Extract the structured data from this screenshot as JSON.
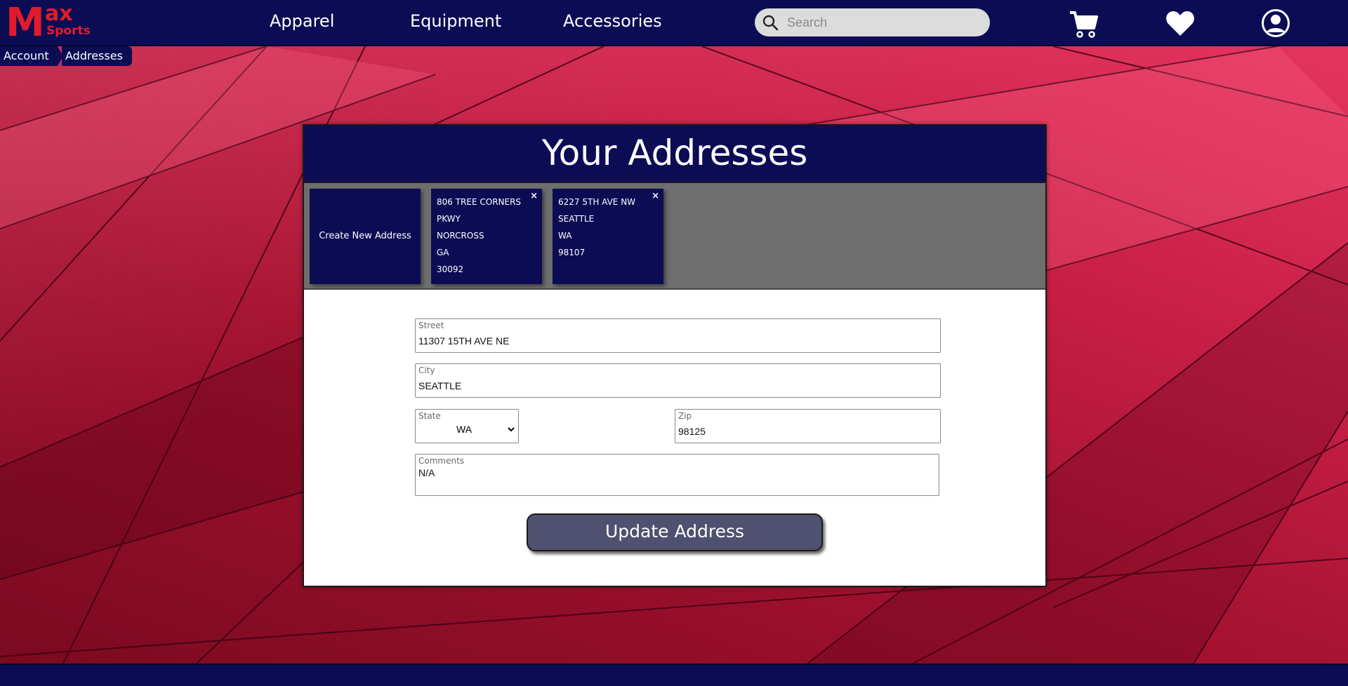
{
  "logo": {
    "m": "M",
    "ax": "ax",
    "sports": "Sports"
  },
  "nav": [
    {
      "label": "Apparel"
    },
    {
      "label": "Equipment"
    },
    {
      "label": "Accessories"
    }
  ],
  "search": {
    "placeholder": "Search",
    "value": ""
  },
  "header_icons": [
    "cart-icon",
    "heart-icon",
    "user-icon"
  ],
  "breadcrumb": [
    {
      "label": "Account"
    },
    {
      "label": "Addresses"
    }
  ],
  "page_title": "Your Addresses",
  "create_card": {
    "label": "Create New Address"
  },
  "address_cards": [
    {
      "lines": [
        "806 TREE CORNERS",
        "PKWY",
        "NORCROSS",
        "GA",
        "30092"
      ],
      "close": "×"
    },
    {
      "lines": [
        "6227 5TH AVE NW",
        "SEATTLE",
        "WA",
        "98107"
      ],
      "close": "×"
    }
  ],
  "form": {
    "street": {
      "label": "Street",
      "value": "11307 15TH AVE NE"
    },
    "city": {
      "label": "City",
      "value": "SEATTLE"
    },
    "state": {
      "label": "State",
      "value": "WA"
    },
    "zip": {
      "label": "Zip",
      "value": "98125"
    },
    "comments": {
      "label": "Comments",
      "value": "N/A"
    }
  },
  "update_button": "Update Address",
  "colors": {
    "navy": "#0c0c55",
    "brand_red": "#e21b2a",
    "button": "#505070",
    "cards_bar": "#6e6e6e"
  }
}
